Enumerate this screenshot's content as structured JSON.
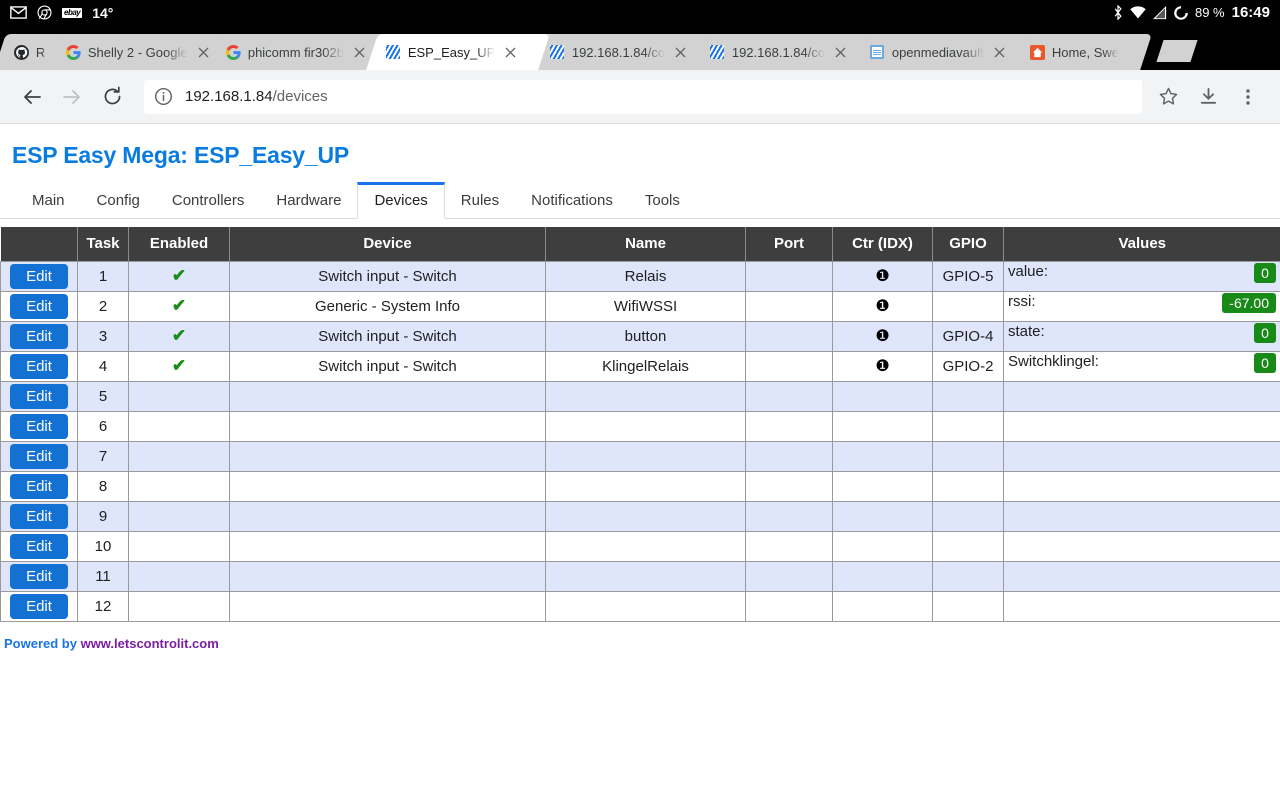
{
  "status_bar": {
    "icons_left": [
      "gmail-icon",
      "chrome-icon",
      "ebay-icon"
    ],
    "temperature": "14°",
    "icons_right": [
      "bluetooth-icon",
      "wifi-icon",
      "signal-icon",
      "battery-icon"
    ],
    "battery": "89 %",
    "clock": "16:49",
    "ebay_label": "ebay"
  },
  "tabs": [
    {
      "title": "R",
      "favicon": "github-icon",
      "active": false
    },
    {
      "title": "Shelly 2 - Google",
      "favicon": "google-icon",
      "active": false
    },
    {
      "title": "phicomm fir302b",
      "favicon": "google-icon",
      "active": false
    },
    {
      "title": "ESP_Easy_UP",
      "favicon": "esp-easy-icon",
      "active": true
    },
    {
      "title": "192.168.1.84/co",
      "favicon": "esp-easy-icon",
      "active": false
    },
    {
      "title": "192.168.1.84/co",
      "favicon": "esp-easy-icon",
      "active": false
    },
    {
      "title": "openmediavault",
      "favicon": "openmediavault-icon",
      "active": false
    },
    {
      "title": "Home, Swe",
      "favicon": "home-assistant-icon",
      "active": false
    }
  ],
  "toolbar": {
    "back_icon": "back-arrow-icon",
    "forward_icon": "forward-arrow-icon",
    "reload_icon": "reload-icon",
    "site_info_icon": "info-circle-icon",
    "url_host": "192.168.1.84",
    "url_path": "/devices",
    "bookmark_icon": "star-icon",
    "download_icon": "download-icon",
    "menu_icon": "three-dot-menu-icon"
  },
  "page": {
    "title": "ESP Easy Mega: ESP_Easy_UP",
    "nav": [
      {
        "label": "Main",
        "active": false
      },
      {
        "label": "Config",
        "active": false
      },
      {
        "label": "Controllers",
        "active": false
      },
      {
        "label": "Hardware",
        "active": false
      },
      {
        "label": "Devices",
        "active": true
      },
      {
        "label": "Rules",
        "active": false
      },
      {
        "label": "Notifications",
        "active": false
      },
      {
        "label": "Tools",
        "active": false
      }
    ],
    "table": {
      "headers": [
        "",
        "Task",
        "Enabled",
        "Device",
        "Name",
        "Port",
        "Ctr (IDX)",
        "GPIO",
        "Values"
      ],
      "edit_label": "Edit",
      "enabled_glyph": "✔",
      "ctr_glyph": "❶",
      "rows": [
        {
          "task": "1",
          "enabled": true,
          "device": "Switch input - Switch",
          "name": "Relais",
          "port": "",
          "ctr": true,
          "gpio": "GPIO-5",
          "value_label": "value:",
          "value": "0"
        },
        {
          "task": "2",
          "enabled": true,
          "device": "Generic - System Info",
          "name": "WifiWSSI",
          "port": "",
          "ctr": true,
          "gpio": "",
          "value_label": "rssi:",
          "value": "-67.00"
        },
        {
          "task": "3",
          "enabled": true,
          "device": "Switch input - Switch",
          "name": "button",
          "port": "",
          "ctr": true,
          "gpio": "GPIO-4",
          "value_label": "state:",
          "value": "0"
        },
        {
          "task": "4",
          "enabled": true,
          "device": "Switch input - Switch",
          "name": "KlingelRelais",
          "port": "",
          "ctr": true,
          "gpio": "GPIO-2",
          "value_label": "Switchklingel:",
          "value": "0"
        },
        {
          "task": "5",
          "enabled": false,
          "device": "",
          "name": "",
          "port": "",
          "ctr": false,
          "gpio": "",
          "value_label": "",
          "value": ""
        },
        {
          "task": "6",
          "enabled": false,
          "device": "",
          "name": "",
          "port": "",
          "ctr": false,
          "gpio": "",
          "value_label": "",
          "value": ""
        },
        {
          "task": "7",
          "enabled": false,
          "device": "",
          "name": "",
          "port": "",
          "ctr": false,
          "gpio": "",
          "value_label": "",
          "value": ""
        },
        {
          "task": "8",
          "enabled": false,
          "device": "",
          "name": "",
          "port": "",
          "ctr": false,
          "gpio": "",
          "value_label": "",
          "value": ""
        },
        {
          "task": "9",
          "enabled": false,
          "device": "",
          "name": "",
          "port": "",
          "ctr": false,
          "gpio": "",
          "value_label": "",
          "value": ""
        },
        {
          "task": "10",
          "enabled": false,
          "device": "",
          "name": "",
          "port": "",
          "ctr": false,
          "gpio": "",
          "value_label": "",
          "value": ""
        },
        {
          "task": "11",
          "enabled": false,
          "device": "",
          "name": "",
          "port": "",
          "ctr": false,
          "gpio": "",
          "value_label": "",
          "value": ""
        },
        {
          "task": "12",
          "enabled": false,
          "device": "",
          "name": "",
          "port": "",
          "ctr": false,
          "gpio": "",
          "value_label": "",
          "value": ""
        }
      ]
    },
    "footer": {
      "prefix": "Powered by ",
      "link": "www.letscontrolit.com"
    }
  },
  "colors": {
    "accent_blue": "#1a73e8",
    "title_blue": "#0a7ce0",
    "badge_green": "#178a17",
    "check_green": "#1a8c1a",
    "header_gray": "#3e3e3e",
    "row_stripe": "#dfe5fb",
    "link_purple": "#7b1fa2"
  }
}
